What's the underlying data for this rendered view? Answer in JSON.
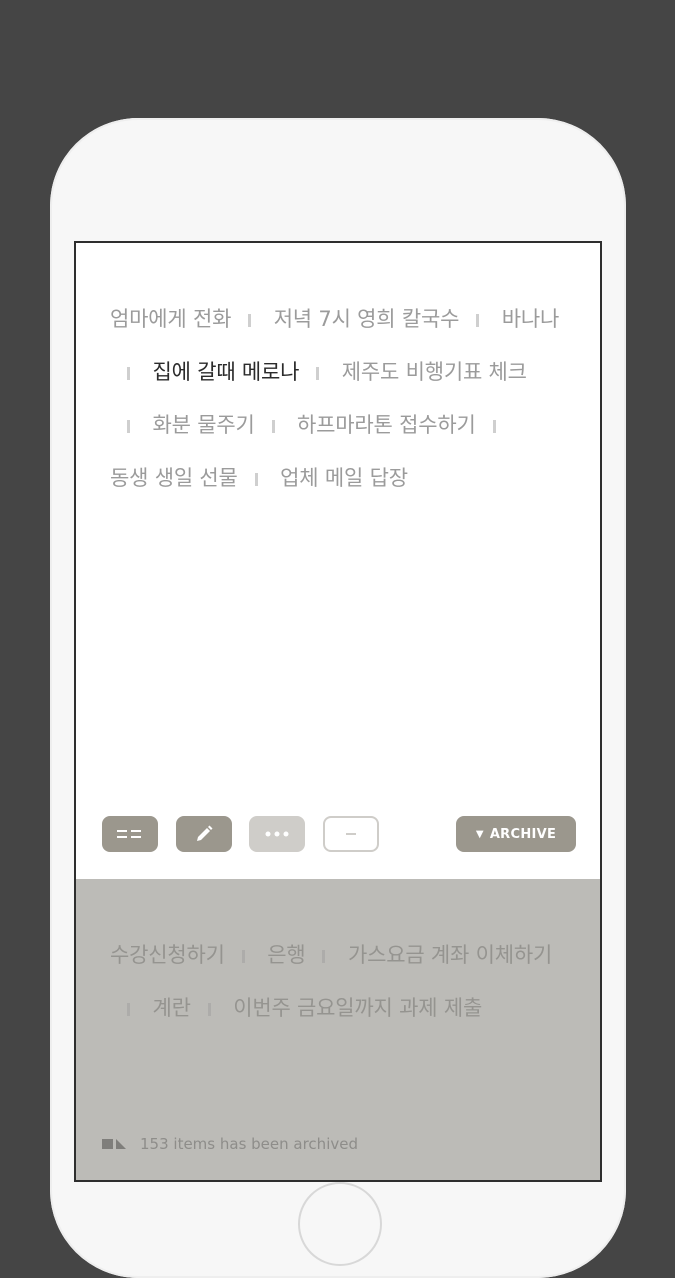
{
  "todos": [
    {
      "text": "엄마에게 전화",
      "active": false
    },
    {
      "text": "저녁 7시 영희 칼국수",
      "active": false
    },
    {
      "text": "바나나",
      "active": false
    },
    {
      "text": "집에 갈때 메로나",
      "active": true
    },
    {
      "text": "제주도 비행기표 체크",
      "active": false
    },
    {
      "text": "화분 물주기",
      "active": false
    },
    {
      "text": "하프마라톤 접수하기",
      "active": false
    },
    {
      "text": "동생 생일 선물",
      "active": false
    },
    {
      "text": "업체 메일 답장",
      "active": false
    }
  ],
  "toolbar": {
    "buttons": [
      {
        "name": "list-view-button",
        "icon": "list-icon",
        "color": "#9b978d"
      },
      {
        "name": "edit-button",
        "icon": "pencil-icon",
        "color": "#9b978d"
      },
      {
        "name": "more-button",
        "icon": "more-dots-icon",
        "color": "#cfcdc9"
      },
      {
        "name": "remove-button",
        "icon": "minus-icon",
        "color": "#ffffff"
      }
    ],
    "archive_label": "ARCHIVE",
    "archive_icon": "triangle-down-icon"
  },
  "archive": {
    "items": [
      "수강신청하기",
      "은행",
      "가스요금 계좌 이체하기",
      "계란",
      "이번주 금요일까지 과제 제출"
    ],
    "footer_text": "153 items has been archived",
    "footer_icon": "archive-box-icon"
  },
  "colors": {
    "background": "#454545",
    "device": "#f7f7f7",
    "active_text": "#2b2b2b",
    "inactive_text": "#9b9b9b",
    "archive_panel": "#bcbbb7",
    "accent_button": "#9b978d"
  }
}
